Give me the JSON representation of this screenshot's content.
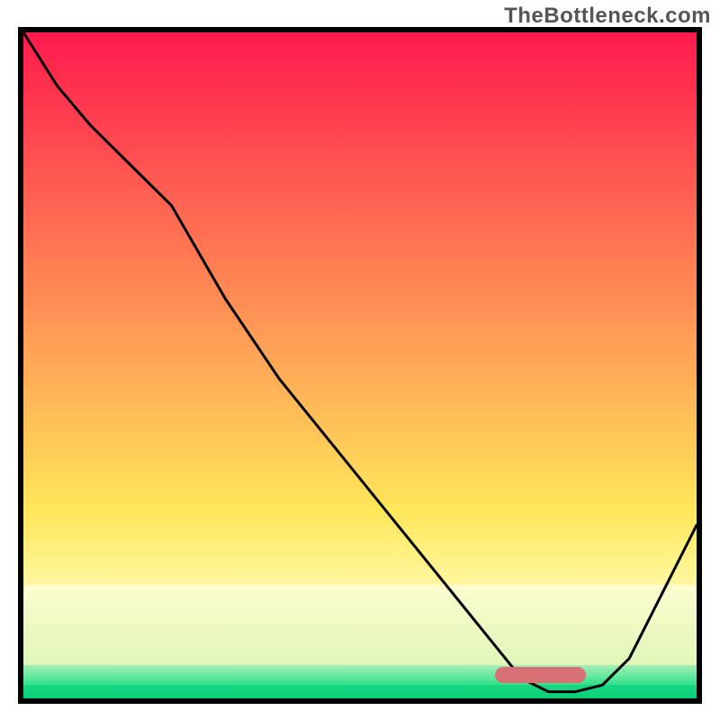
{
  "watermark": "TheBottleneck.com",
  "colors": {
    "curve": "#000000",
    "frame": "#000000",
    "marker": "#d87076"
  },
  "gradient_bands": [
    {
      "top_pct": 0.0,
      "height_pct": 72.0,
      "from": "#ff1a4d",
      "to": "#ffe75a"
    },
    {
      "top_pct": 72.0,
      "height_pct": 11.0,
      "from": "#ffe75a",
      "to": "#fff7a0"
    },
    {
      "top_pct": 83.0,
      "height_pct": 12.0,
      "from": "#fdfccf",
      "to": "#dff7b8"
    },
    {
      "top_pct": 95.0,
      "height_pct": 3.0,
      "from": "#a8efb6",
      "to": "#2fe28a"
    },
    {
      "top_pct": 98.0,
      "height_pct": 2.0,
      "from": "#18d880",
      "to": "#0ad078"
    }
  ],
  "marker": {
    "left_pct": 70.0,
    "top_pct": 95.3,
    "width_pct": 13.5,
    "height_pct": 2.4
  },
  "chart_data": {
    "type": "line",
    "title": "",
    "xlabel": "",
    "ylabel": "",
    "xlim": [
      0,
      100
    ],
    "ylim": [
      0,
      100
    ],
    "x": [
      0,
      5,
      10,
      16,
      22,
      30,
      38,
      46,
      54,
      62,
      70,
      74,
      78,
      82,
      86,
      90,
      94,
      100
    ],
    "values": [
      0,
      8,
      14,
      20,
      26,
      40,
      52,
      62,
      72,
      82,
      92,
      97,
      99,
      99,
      98,
      94,
      86,
      74
    ],
    "optimal_range_x": [
      70,
      83
    ],
    "note": "x is a relative horizontal axis (0–100, left→right). values are relative vertical positions (0 = top of plot, 100 = bottom green band). The curve descends from upper-left, bottoms out near x≈74–82 (optimal / marker region), then rises toward the right edge."
  }
}
